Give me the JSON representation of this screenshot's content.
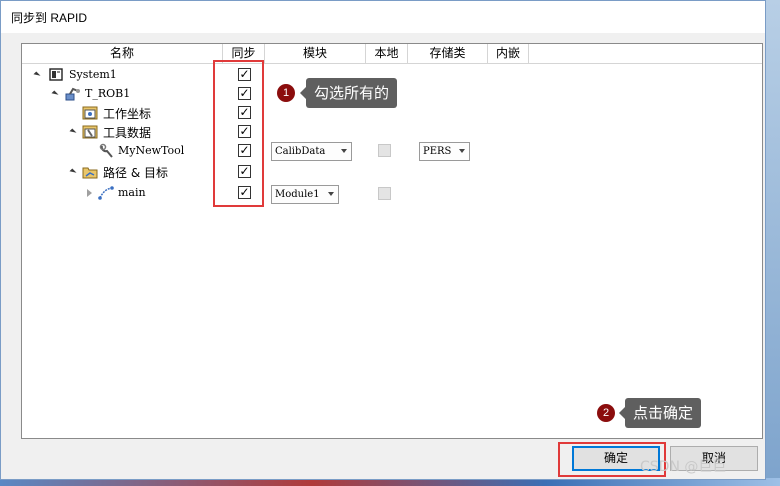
{
  "window": {
    "title": "同步到 RAPID"
  },
  "columns": [
    "名称",
    "同步",
    "模块",
    "本地",
    "存储类",
    "内嵌"
  ],
  "tree": [
    {
      "label": "System1",
      "icon": "controller-icon",
      "expander": "open",
      "checked": true
    },
    {
      "label": "T_ROB1",
      "icon": "robot-task-icon",
      "expander": "open",
      "checked": true
    },
    {
      "label": "工作坐标",
      "icon": "workobject-icon",
      "expander": "none",
      "checked": true
    },
    {
      "label": "工具数据",
      "icon": "tooldata-icon",
      "expander": "open",
      "checked": true
    },
    {
      "label": "MyNewTool",
      "icon": "tool-icon",
      "expander": "none",
      "checked": true,
      "module": "CalibData",
      "storage": "PERS"
    },
    {
      "label": "路径 & 目标",
      "icon": "paths-folder-icon",
      "expander": "open",
      "checked": true
    },
    {
      "label": "main",
      "icon": "path-icon",
      "expander": "closed",
      "checked": true,
      "module": "Module1"
    }
  ],
  "callouts": {
    "step1": {
      "number": "1",
      "text": "勾选所有的"
    },
    "step2": {
      "number": "2",
      "text": "点击确定"
    }
  },
  "buttons": {
    "ok": "确定",
    "cancel": "取消"
  },
  "watermark": "CSDN @巨巨",
  "colors": {
    "highlight_border": "#e03a3a",
    "badge": "#8b0d0d",
    "callout_bg": "#5f5f5f",
    "primary_button_border": "#0078d7"
  }
}
